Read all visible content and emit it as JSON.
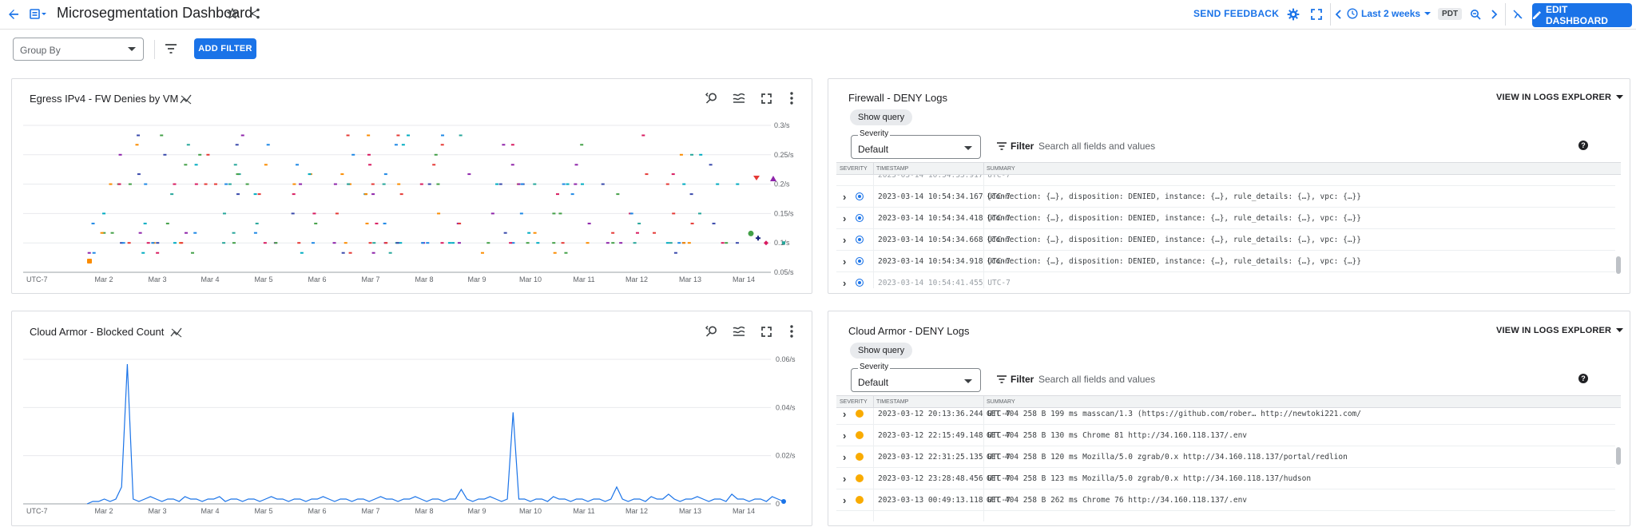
{
  "header": {
    "title": "Microsegmentation Dashboard",
    "feedback": "SEND FEEDBACK",
    "time_range": "Last 2 weeks",
    "tz": "PDT",
    "edit": "EDIT DASHBOARD"
  },
  "toolbar": {
    "group_by": "Group By",
    "add_filter": "ADD FILTER"
  },
  "charts": {
    "egress": {
      "title": "Egress IPv4 - FW Denies by VM",
      "yticks": [
        "0.3/s",
        "0.25/s",
        "0.2/s",
        "0.15/s",
        "0.1/s",
        "0.05/s"
      ],
      "xticks": [
        "UTC-7",
        "Mar 2",
        "Mar 3",
        "Mar 4",
        "Mar 5",
        "Mar 6",
        "Mar 7",
        "Mar 8",
        "Mar 9",
        "Mar 10",
        "Mar 11",
        "Mar 12",
        "Mar 13",
        "Mar 14"
      ]
    },
    "armor": {
      "title": "Cloud Armor - Blocked Count",
      "yticks": [
        "0.06/s",
        "0.04/s",
        "0.02/s",
        "0"
      ],
      "xticks": [
        "UTC-7",
        "Mar 2",
        "Mar 3",
        "Mar 4",
        "Mar 5",
        "Mar 6",
        "Mar 7",
        "Mar 8",
        "Mar 9",
        "Mar 10",
        "Mar 11",
        "Mar 12",
        "Mar 13",
        "Mar 14"
      ]
    }
  },
  "chart_data": [
    {
      "type": "scatter",
      "title": "Egress IPv4 - FW Denies by VM",
      "ylim": [
        0.05,
        0.3
      ],
      "yaxis_unit": "/s",
      "x_ticks": [
        "UTC-7",
        "Mar 2",
        "Mar 3",
        "Mar 4",
        "Mar 5",
        "Mar 6",
        "Mar 7",
        "Mar 8",
        "Mar 9",
        "Mar 10",
        "Mar 11",
        "Mar 12",
        "Mar 13",
        "Mar 14"
      ],
      "description_levels": [
        0.283,
        0.267,
        0.25,
        0.233,
        0.217,
        0.2,
        0.183,
        0.15,
        0.133,
        0.117,
        0.1,
        0.083
      ]
    },
    {
      "type": "line",
      "title": "Cloud Armor - Blocked Count",
      "ylim": [
        0,
        0.06
      ],
      "series": [
        {
          "values": [
            0,
            0.001,
            0.001,
            0.002,
            0.001,
            0.002,
            0.007,
            0.058,
            0.002,
            0.001,
            0.002,
            0.003,
            0.002,
            0.001,
            0.002,
            0.002,
            0.001,
            0.003,
            0.002,
            0.002,
            0.001,
            0.002,
            0.002,
            0.003,
            0.001,
            0.002,
            0.002,
            0.001,
            0.002,
            0.002,
            0.001,
            0.002,
            0.003,
            0.002,
            0.002,
            0.001,
            0.002,
            0.002,
            0.001,
            0.002,
            0.002,
            0.003,
            0.002,
            0.001,
            0.002,
            0.002,
            0.001,
            0.002,
            0.002,
            0.001,
            0.002,
            0.003,
            0.002,
            0.002,
            0.001,
            0.002,
            0.002,
            0.003,
            0.002,
            0.001,
            0.002,
            0.002,
            0.001,
            0.002,
            0.002,
            0.006,
            0.002,
            0.001,
            0.002,
            0.002,
            0.003,
            0.002,
            0.001,
            0.002,
            0.038,
            0.002,
            0.002,
            0.001,
            0.002,
            0.002,
            0.001,
            0.003,
            0.002,
            0.002,
            0.001,
            0.002,
            0.002,
            0.001,
            0.002,
            0.002,
            0.001,
            0.002,
            0.007,
            0.002,
            0.001,
            0.002,
            0.002,
            0.001,
            0.003,
            0.002,
            0.002,
            0.004,
            0.002,
            0.001,
            0.002,
            0.002,
            0.003,
            0.002,
            0.001,
            0.002,
            0.002,
            0.001,
            0.004,
            0.002,
            0.002,
            0.001,
            0.002,
            0.002,
            0.001,
            0.003,
            0.002,
            0.001
          ]
        }
      ]
    }
  ],
  "fw_logs": {
    "title": "Firewall - DENY Logs",
    "show_query": "Show query",
    "sev_label": "Severity",
    "sev_value": "Default",
    "filter": "Filter",
    "filter_ph": "Search all fields and values",
    "view": "VIEW IN LOGS EXPLORER",
    "col_sev": "SEVERITY",
    "col_ts": "TIMESTAMP",
    "col_sum": "SUMMARY",
    "rows": [
      {
        "ts": "2023-03-14 10:54:34.167 UTC-7",
        "sum": "{connection: {…}, disposition: DENIED, instance: {…}, rule_details: {…}, vpc: {…}}"
      },
      {
        "ts": "2023-03-14 10:54:34.418 UTC-7",
        "sum": "{connection: {…}, disposition: DENIED, instance: {…}, rule_details: {…}, vpc: {…}}"
      },
      {
        "ts": "2023-03-14 10:54:34.668 UTC-7",
        "sum": "{connection: {…}, disposition: DENIED, instance: {…}, rule_details: {…}, vpc: {…}}"
      },
      {
        "ts": "2023-03-14 10:54:34.918 UTC-7",
        "sum": "{connection: {…}, disposition: DENIED, instance: {…}, rule_details: {…}, vpc: {…}}"
      }
    ]
  },
  "armor_logs": {
    "title": "Cloud Armor - DENY Logs",
    "show_query": "Show query",
    "sev_label": "Severity",
    "sev_value": "Default",
    "filter": "Filter",
    "filter_ph": "Search all fields and values",
    "view": "VIEW IN LOGS EXPLORER",
    "col_sev": "SEVERITY",
    "col_ts": "TIMESTAMP",
    "col_sum": "SUMMARY",
    "rows": [
      {
        "ts": "2023-03-12 20:13:36.244 UTC-7",
        "sum": "GET  404  258 B  199 ms  masscan/1.3 (https://github.com/rober…   http://newtoki221.com/"
      },
      {
        "ts": "2023-03-12 22:15:49.148 UTC-7",
        "sum": "GET  404  258 B  130 ms  Chrome 81   http://34.160.118.137/.env"
      },
      {
        "ts": "2023-03-12 22:31:25.135 UTC-7",
        "sum": "GET  404  258 B  120 ms  Mozilla/5.0 zgrab/0.x   http://34.160.118.137/portal/redlion"
      },
      {
        "ts": "2023-03-12 23:28:48.456 UTC-7",
        "sum": "GET  404  258 B  123 ms  Mozilla/5.0 zgrab/0.x   http://34.160.118.137/hudson"
      },
      {
        "ts": "2023-03-13 00:49:13.118 UTC-7",
        "sum": "GET  404  258 B  262 ms  Chrome 76   http://34.160.118.137/.env"
      }
    ]
  },
  "colors": {
    "accent": "#1a73e8",
    "line": "#1a73e8",
    "warn": "#f9ab00"
  }
}
